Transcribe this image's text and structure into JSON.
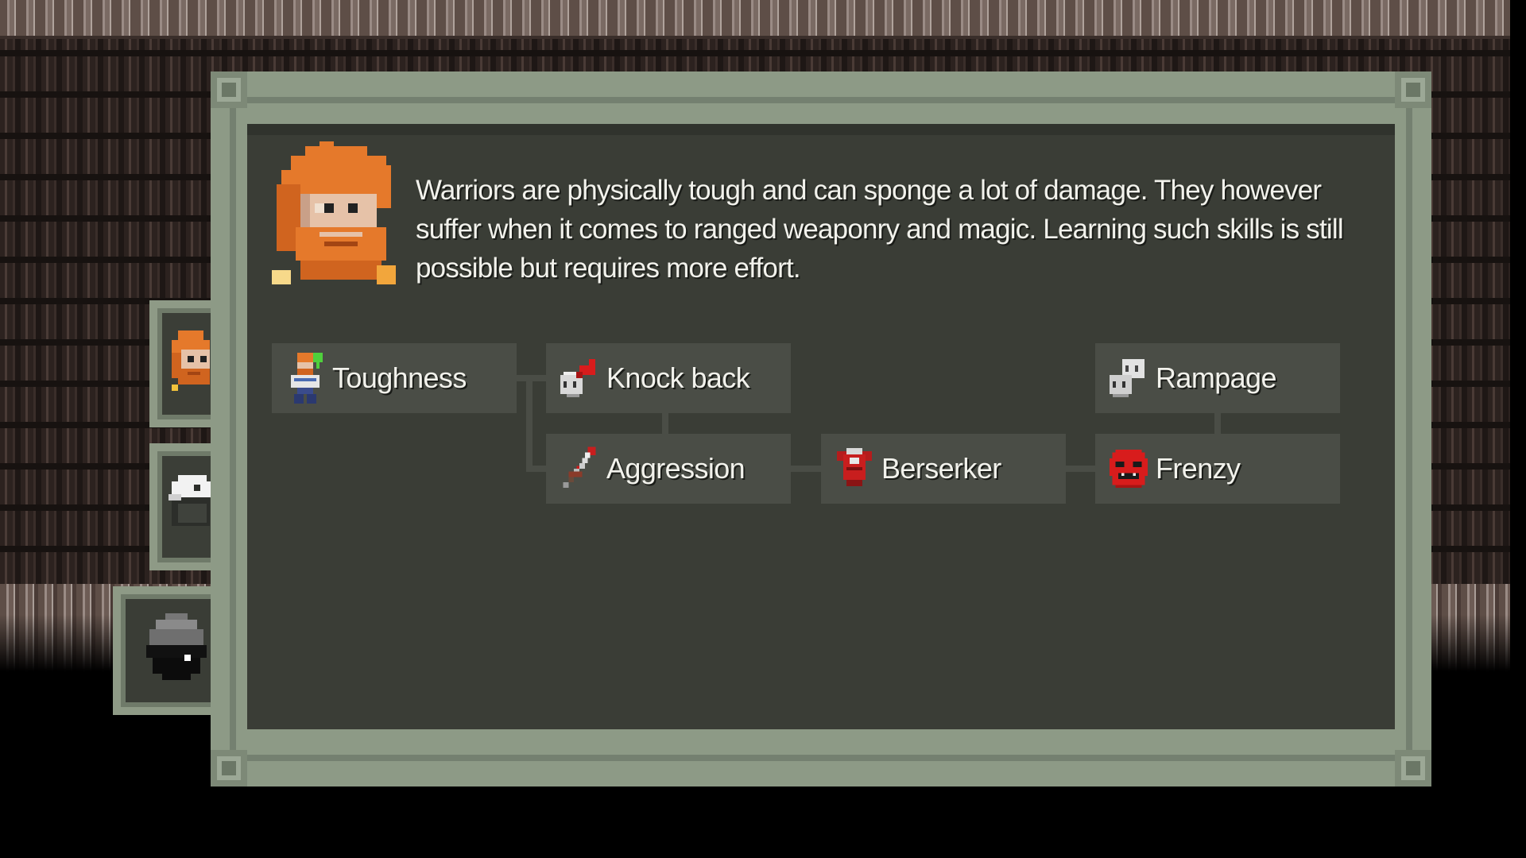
{
  "class_tabs": [
    {
      "name": "Warrior",
      "icon": "warrior-portrait-icon",
      "active": false
    },
    {
      "name": "Rogue",
      "icon": "rogue-hood-icon",
      "active": false
    },
    {
      "name": "Mage",
      "icon": "mage-hood-icon",
      "active": true
    }
  ],
  "hero": {
    "portrait_icon": "warrior-portrait-icon",
    "description": "Warriors are physically tough and can sponge a lot of damage. They however suffer when it comes to ranged weaponry and magic. Learning such skills is still possible but requires more effort."
  },
  "skills": {
    "toughness": {
      "label": "Toughness",
      "icon": "warrior-figure-icon"
    },
    "knockback": {
      "label": "Knock back",
      "icon": "fist-arrow-icon"
    },
    "rampage": {
      "label": "Rampage",
      "icon": "double-fist-icon"
    },
    "aggression": {
      "label": "Aggression",
      "icon": "bloody-sword-icon"
    },
    "berserker": {
      "label": "Berserker",
      "icon": "red-armor-icon"
    },
    "frenzy": {
      "label": "Frenzy",
      "icon": "red-mask-icon"
    }
  },
  "colors": {
    "panel_frame": "#8d9a86",
    "panel_body": "#3a3d36",
    "skill_box": "#4a4d46",
    "text": "#f2f2ec",
    "hair": "#e5792b",
    "frenzy_red": "#d81c1c"
  }
}
